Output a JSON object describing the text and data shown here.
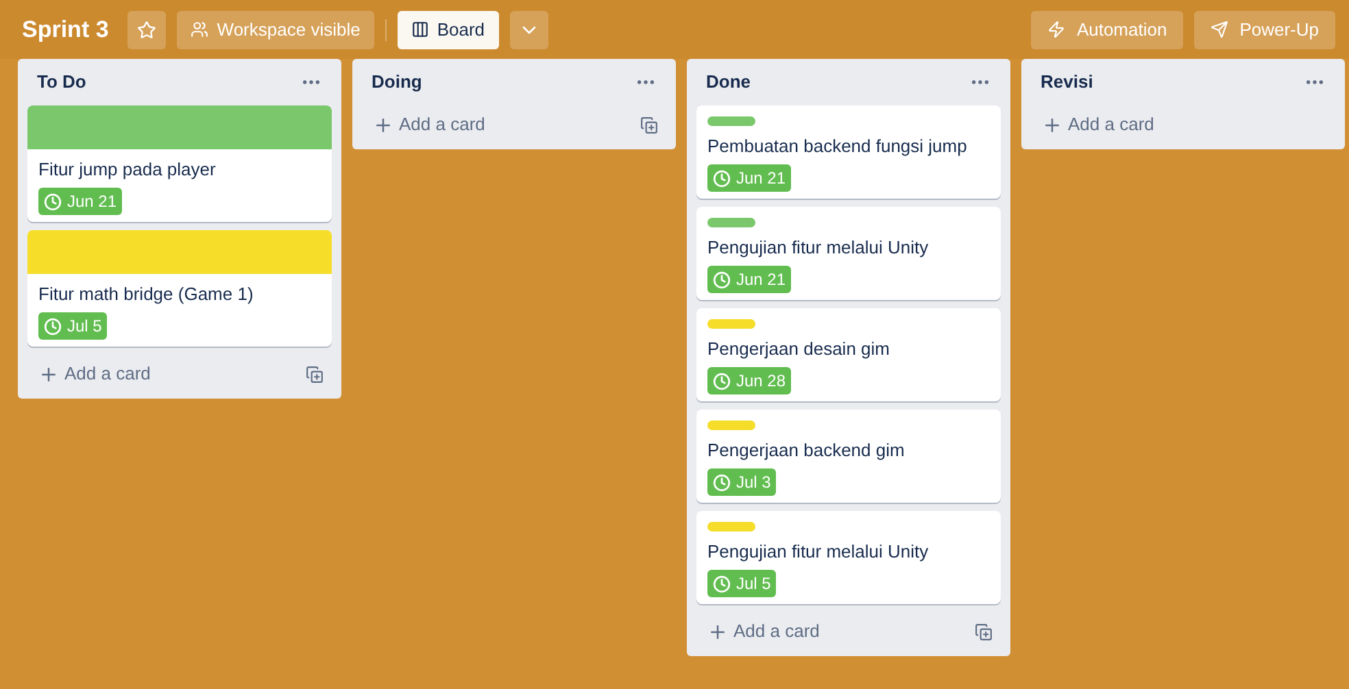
{
  "board": {
    "title": "Sprint 3",
    "visibility": "Workspace visible",
    "views": [
      {
        "label": "Board",
        "selected": true
      }
    ],
    "actions": [
      "Automation",
      "Power-Up"
    ]
  },
  "lists": [
    {
      "title": "To Do",
      "add_label": "Add a card",
      "template_button": true,
      "cards": [
        {
          "title": "Fitur jump pada player",
          "label": {
            "kind": "cover",
            "color": "#7bc86c"
          },
          "due": "Jun 21"
        },
        {
          "title": "Fitur math bridge (Game 1)",
          "label": {
            "kind": "cover",
            "color": "#f5dd29"
          },
          "due": "Jul 5"
        }
      ]
    },
    {
      "title": "Doing",
      "add_label": "Add a card",
      "template_button": true
    },
    {
      "title": "Done",
      "add_label": "Add a card",
      "template_button": true,
      "cards": [
        {
          "title": "Pembuatan backend fungsi jump",
          "label": {
            "kind": "bar",
            "color": "#7bc86c"
          },
          "due": "Jun 21"
        },
        {
          "title": "Pengujian fitur melalui Unity",
          "label": {
            "kind": "bar",
            "color": "#7bc86c"
          },
          "due": "Jun 21"
        },
        {
          "title": "Pengerjaan desain gim",
          "label": {
            "kind": "bar",
            "color": "#f5dd29"
          },
          "due": "Jun 28"
        },
        {
          "title": "Pengerjaan backend gim",
          "label": {
            "kind": "bar",
            "color": "#f5dd29"
          },
          "due": "Jul 3"
        },
        {
          "title": "Pengujian fitur melalui Unity",
          "label": {
            "kind": "bar",
            "color": "#f5dd29"
          },
          "due": "Jul 5"
        }
      ]
    },
    {
      "title": "Revisi",
      "add_label": "Add a card",
      "template_button": false
    }
  ]
}
